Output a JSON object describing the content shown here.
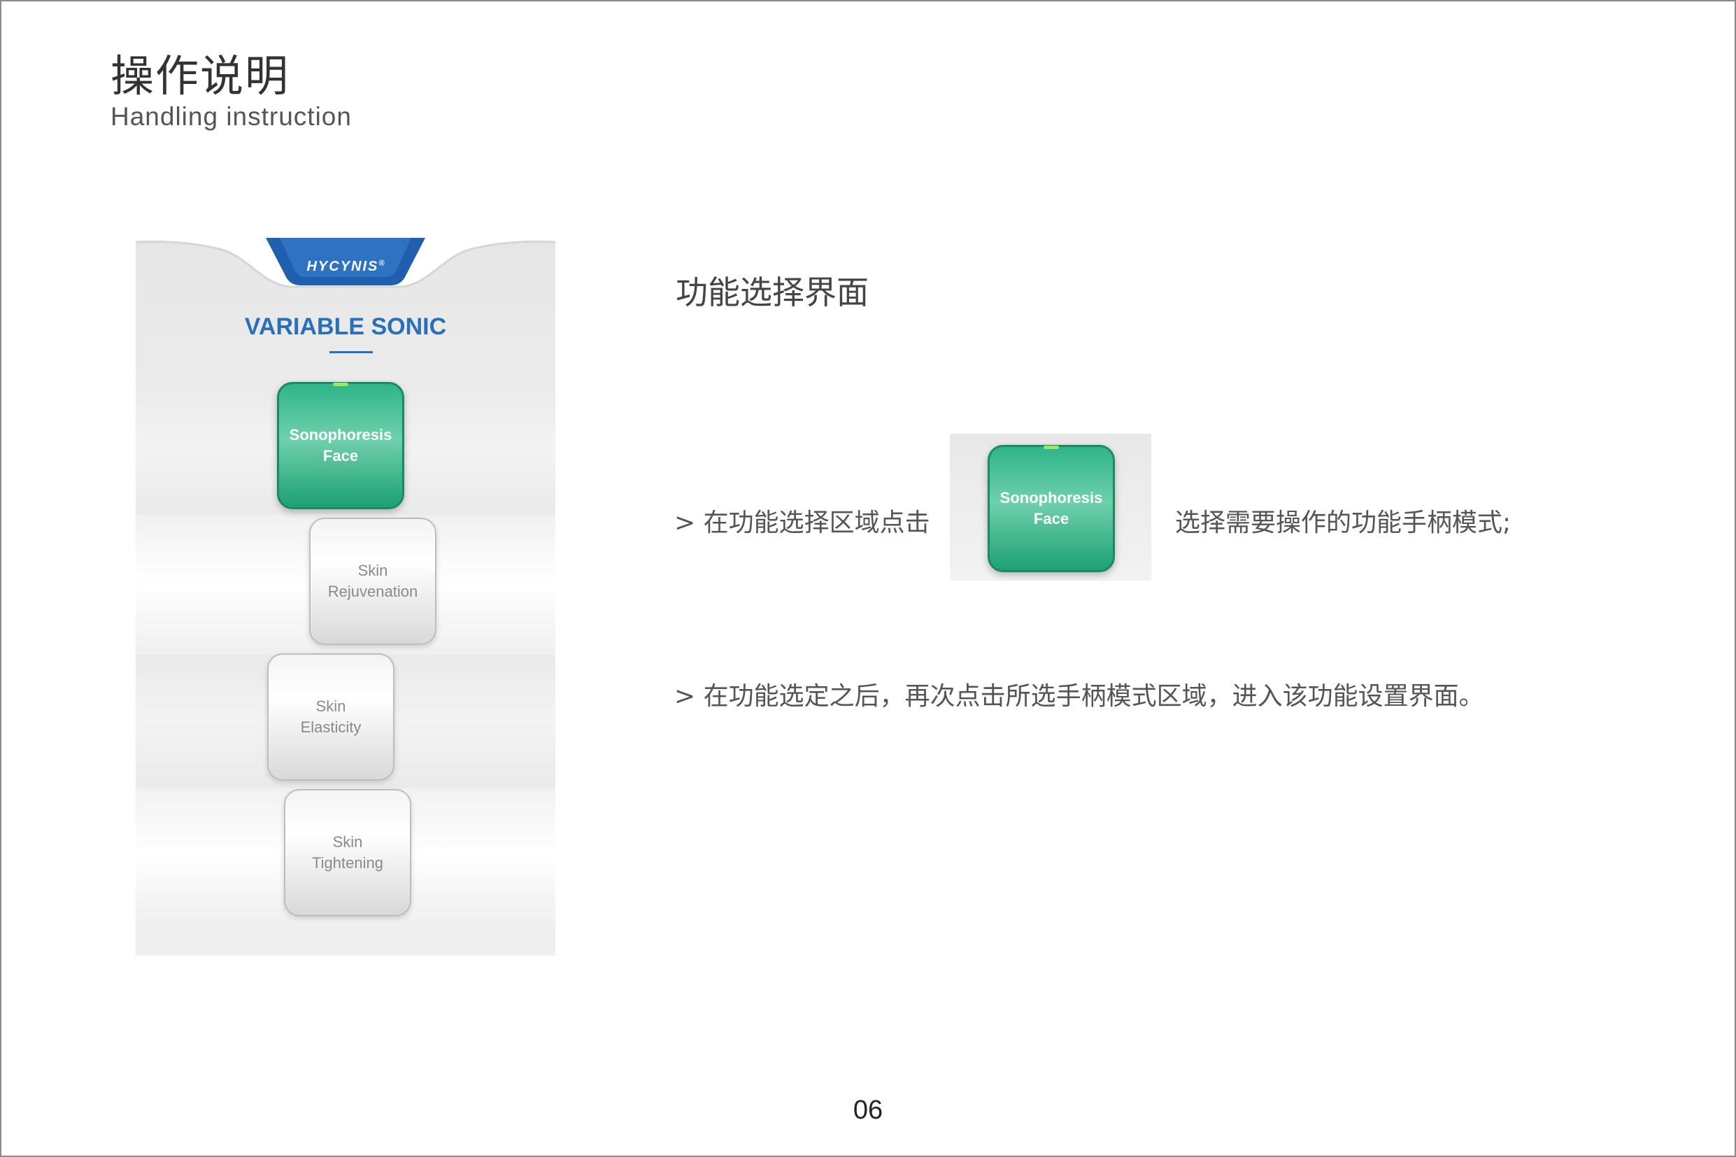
{
  "page": {
    "title_cn": "操作说明",
    "title_en": "Handling instruction",
    "page_number": "06"
  },
  "device": {
    "logo": "HYCYNIS",
    "logo_mark": "®",
    "app_title": "VARIABLE SONIC",
    "modes": [
      {
        "line1": "Sonophoresis",
        "line2": "Face",
        "state": "selected"
      },
      {
        "line1": "Skin",
        "line2": "Rejuvenation",
        "state": "normal"
      },
      {
        "line1": "Skin",
        "line2": "Elasticity",
        "state": "normal"
      },
      {
        "line1": "Skin",
        "line2": "Tightening",
        "state": "normal"
      }
    ],
    "colors": {
      "brand_blue": "#2a6fb8",
      "active_green": "#2fb588"
    }
  },
  "instructions": {
    "section_title": "功能选择界面",
    "step1_before": "> 在功能选择区域点击",
    "step1_after": "选择需要操作的功能手柄模式;",
    "step1_button": {
      "line1": "Sonophoresis",
      "line2": "Face"
    },
    "step2": "> 在功能选定之后，再次点击所选手柄模式区域，进入该功能设置界面。"
  }
}
